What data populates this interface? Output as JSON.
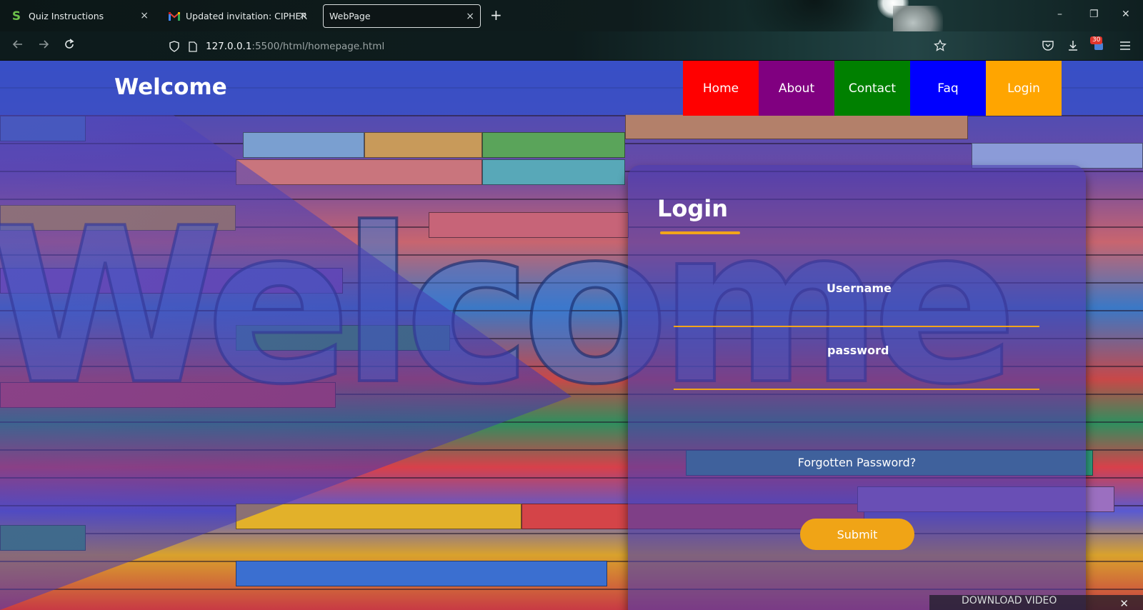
{
  "browser": {
    "tabs": [
      {
        "title": "Quiz Instructions",
        "close": "×"
      },
      {
        "title": "Updated invitation: CIPHER CLA",
        "close": "×"
      },
      {
        "title": "WebPage",
        "close": "×"
      }
    ],
    "new_tab": "+",
    "window_controls": {
      "minimize": "–",
      "restore": "❐",
      "close": "✕"
    },
    "url": {
      "host": "127.0.0.1",
      "rest": ":5500/html/homepage.html"
    },
    "badge_count": "30"
  },
  "page": {
    "site_title": "Welcome",
    "background_word": "Welcome",
    "menu": [
      {
        "label": "Home",
        "color": "#ff0000"
      },
      {
        "label": "About",
        "color": "#800080"
      },
      {
        "label": "Contact",
        "color": "#008000"
      },
      {
        "label": "Faq",
        "color": "#0000ff"
      },
      {
        "label": "Login",
        "color": "#ffa500"
      }
    ],
    "login": {
      "title": "Login",
      "username_label": "Username",
      "password_label": "password",
      "forgot": "Forgotten Password?",
      "submit": "Submit"
    }
  },
  "download_popup": {
    "label": "DOWNLOAD VIDEO",
    "close": "✕"
  },
  "colors": {
    "accent": "#f2a51a"
  }
}
